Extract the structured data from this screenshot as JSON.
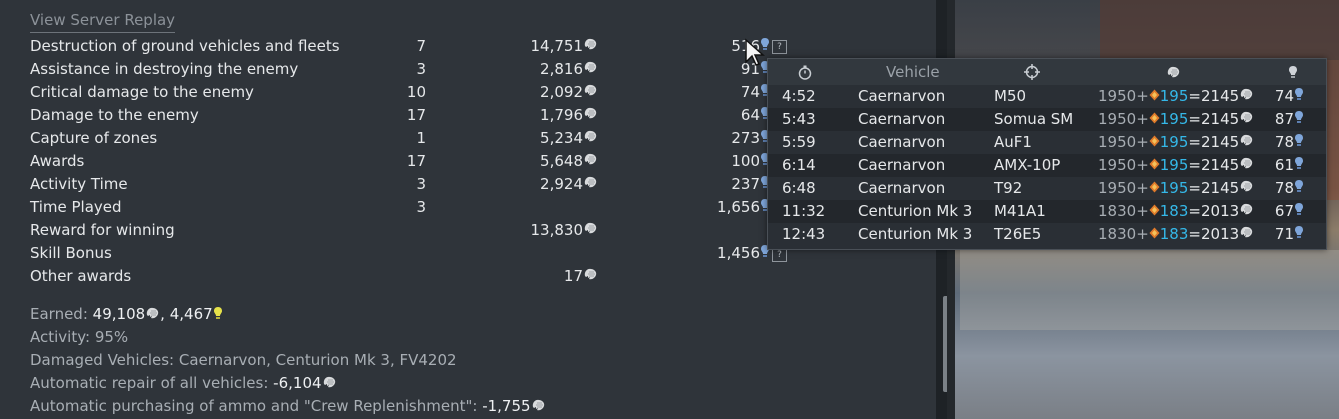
{
  "link": {
    "view_replay": "View Server Replay"
  },
  "rows": [
    {
      "label": "Destruction of ground vehicles and fleets",
      "count": "7",
      "sl": "14,751",
      "rp": "516"
    },
    {
      "label": "Assistance in destroying the enemy",
      "count": "3",
      "sl": "2,816",
      "rp": "91"
    },
    {
      "label": "Critical damage to the enemy",
      "count": "10",
      "sl": "2,092",
      "rp": "74"
    },
    {
      "label": "Damage to the enemy",
      "count": "17",
      "sl": "1,796",
      "rp": "64"
    },
    {
      "label": "Capture of zones",
      "count": "1",
      "sl": "5,234",
      "rp": "273"
    },
    {
      "label": "Awards",
      "count": "17",
      "sl": "5,648",
      "rp": "100"
    },
    {
      "label": "Activity Time",
      "count": "3",
      "sl": "2,924",
      "rp": "237"
    },
    {
      "label": "Time Played",
      "count": "3",
      "sl": "",
      "rp": "1,656"
    },
    {
      "label": "Reward for winning",
      "count": "",
      "sl": "13,830",
      "rp": ""
    },
    {
      "label": "Skill Bonus",
      "count": "",
      "sl": "",
      "rp": "1,456"
    },
    {
      "label": "Other awards",
      "count": "",
      "sl": "17",
      "rp": ""
    }
  ],
  "help_glyph": "?",
  "summary": {
    "earned_label": "Earned:",
    "earned_sl": "49,108",
    "earned_sep": ",",
    "earned_rp": "4,467",
    "activity": "Activity: 95%",
    "damaged": "Damaged Vehicles: Caernarvon, Centurion Mk 3, FV4202",
    "repair_label": "Automatic repair of all vehicles:",
    "repair_value": "-6,104",
    "ammo_label": "Automatic purchasing of ammo and \"Crew Replenishment\":",
    "ammo_value": "-1,755"
  },
  "tooltip": {
    "header": {
      "vehicle": "Vehicle"
    },
    "rows": [
      {
        "time": "4:52",
        "vehicle": "Caernarvon",
        "target": "M50",
        "base": "1950",
        "plus": "+",
        "bonus": "195",
        "eq": "=",
        "total": "2145",
        "rp": "74"
      },
      {
        "time": "5:43",
        "vehicle": "Caernarvon",
        "target": "Somua SM",
        "base": "1950",
        "plus": "+",
        "bonus": "195",
        "eq": "=",
        "total": "2145",
        "rp": "87"
      },
      {
        "time": "5:59",
        "vehicle": "Caernarvon",
        "target": "AuF1",
        "base": "1950",
        "plus": "+",
        "bonus": "195",
        "eq": "=",
        "total": "2145",
        "rp": "78"
      },
      {
        "time": "6:14",
        "vehicle": "Caernarvon",
        "target": "AMX-10P",
        "base": "1950",
        "plus": "+",
        "bonus": "195",
        "eq": "=",
        "total": "2145",
        "rp": "61"
      },
      {
        "time": "6:48",
        "vehicle": "Caernarvon",
        "target": "T92",
        "base": "1950",
        "plus": "+",
        "bonus": "195",
        "eq": "=",
        "total": "2145",
        "rp": "78"
      },
      {
        "time": "11:32",
        "vehicle": "Centurion Mk 3",
        "target": "M41A1",
        "base": "1830",
        "plus": "+",
        "bonus": "183",
        "eq": "=",
        "total": "2013",
        "rp": "67"
      },
      {
        "time": "12:43",
        "vehicle": "Centurion Mk 3",
        "target": "T26E5",
        "base": "1830",
        "plus": "+",
        "bonus": "183",
        "eq": "=",
        "total": "2013",
        "rp": "71"
      }
    ]
  },
  "icons": {
    "silver_lions": "lion-head-icon",
    "research_points": "bulb-icon",
    "premium_bulb": "yellow-bulb-icon",
    "stopwatch": "stopwatch-icon",
    "crosshair": "crosshair-icon",
    "booster": "diamond-booster-icon"
  },
  "colors": {
    "rp_blue": "#7fa6da",
    "bonus_blue": "#35b8e8",
    "premium_yellow": "#e6e24a",
    "booster_orange": "#e07a2a"
  }
}
